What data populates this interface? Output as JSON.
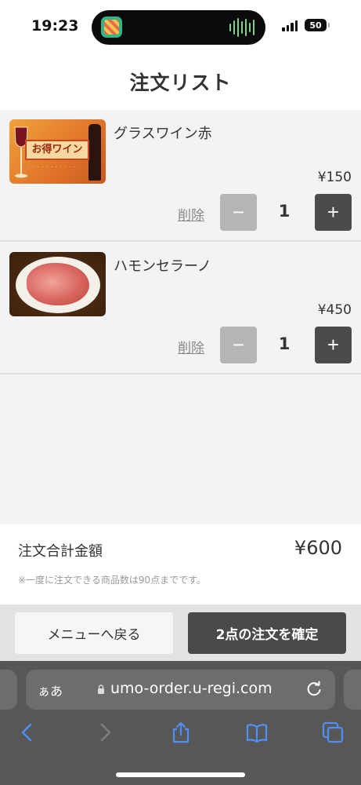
{
  "status_bar": {
    "time": "19:23",
    "battery": "50"
  },
  "header": {
    "title": "注文リスト"
  },
  "items": [
    {
      "name": "グラスワイン赤",
      "price": "¥150",
      "quantity": "1",
      "delete_label": "削除",
      "thumb_label": "お得ワイン",
      "thumb_icon": "wine-thumbnail"
    },
    {
      "name": "ハモンセラーノ",
      "price": "¥450",
      "quantity": "1",
      "delete_label": "削除",
      "thumb_icon": "jamon-thumbnail"
    }
  ],
  "controls": {
    "minus": "−",
    "plus": "+"
  },
  "total": {
    "label": "注文合計金額",
    "value": "¥600",
    "note": "※一度に注文できる商品数は90点までです。"
  },
  "actions": {
    "back_label": "メニューへ戻る",
    "confirm_label": "2点の注文を確定"
  },
  "browser": {
    "aa_label": "ぁあ",
    "url": "umo-order.u-regi.com"
  },
  "colors": {
    "accent_dark": "#4a4a4a",
    "minus_disabled": "#b5b5b5",
    "list_bg": "#f3f3f3",
    "browser_bar": "#575757",
    "toolbar_icon": "#4f8ff7"
  }
}
